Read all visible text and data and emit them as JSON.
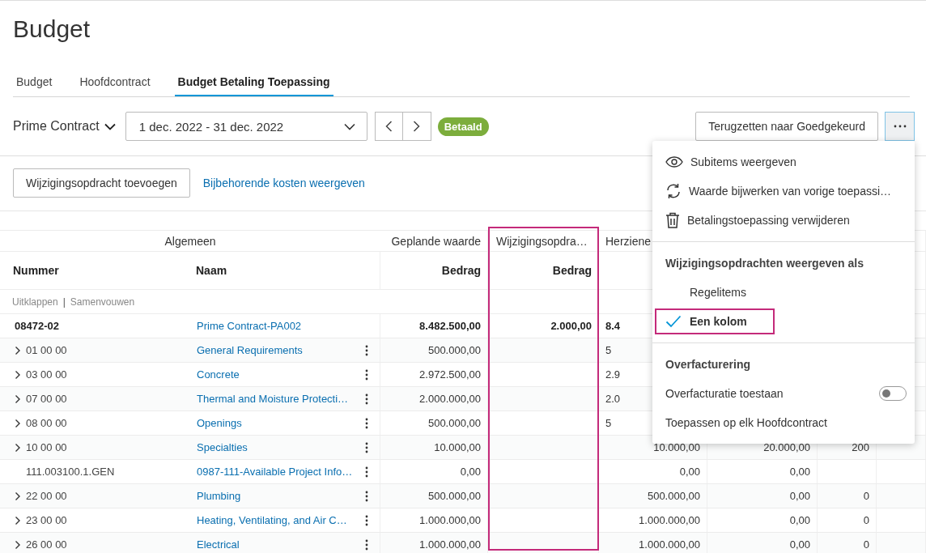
{
  "page_title": "Budget",
  "tabs": [
    {
      "label": "Budget",
      "selected": false
    },
    {
      "label": "Hoofdcontract",
      "selected": false
    },
    {
      "label": "Budget Betaling Toepassing",
      "selected": true
    }
  ],
  "contract_selector": "Prime Contract",
  "period": "1 dec. 2022 - 31 dec. 2022",
  "status_badge": "Betaald",
  "revert_button": "Terugzetten naar Goedgekeurd",
  "add_button": "Wijzigingsopdracht toevoegen",
  "costs_link": "Bijbehorende kosten weergeven",
  "table": {
    "group_headers": [
      {
        "label": "Algemeen",
        "highlighted": false
      },
      {
        "label": "Geplande waarde",
        "highlighted": false
      },
      {
        "label": "Wijzigingsopdra…",
        "highlighted": true
      },
      {
        "label": "Herziene",
        "highlighted": false
      }
    ],
    "columns": [
      "Nummer",
      "Naam",
      "Bedrag",
      "Bedrag"
    ],
    "expand_link": "Uitklappen",
    "separator": "|",
    "collapse_link": "Samenvouwen",
    "rows": [
      {
        "kind": "total",
        "expandable": false,
        "number": "08472-02",
        "name": "Prime Contract-PA002",
        "planned": "8.482.500,00",
        "change": "2.000,00",
        "revised": "8.4",
        "covered": true
      },
      {
        "kind": "item",
        "expandable": true,
        "number": "01 00 00",
        "name": "General Requirements",
        "planned": "500.000,00",
        "revised": "5",
        "covered": true
      },
      {
        "kind": "item",
        "expandable": true,
        "number": "03 00 00",
        "name": "Concrete",
        "planned": "2.972.500,00",
        "revised": "2.9",
        "covered": true
      },
      {
        "kind": "item",
        "expandable": true,
        "number": "07 00 00",
        "name": "Thermal and Moisture Protecti…",
        "planned": "2.000.000,00",
        "revised": "2.0",
        "covered": true
      },
      {
        "kind": "item",
        "expandable": true,
        "number": "08 00 00",
        "name": "Openings",
        "planned": "500.000,00",
        "revised": "5",
        "covered": true
      },
      {
        "kind": "item",
        "expandable": true,
        "number": "10 00 00",
        "name": "Specialties",
        "planned": "10.000,00",
        "revised": "10.000,00",
        "column_6": "20.000,00",
        "column_7": "200",
        "covered": false
      },
      {
        "kind": "item",
        "expandable": false,
        "number": "111.003100.1.GEN",
        "name": "0987-111-Available Project Info…",
        "planned": "0,00",
        "revised": "0,00",
        "column_6": "0,00",
        "covered": false
      },
      {
        "kind": "item",
        "expandable": true,
        "number": "22 00 00",
        "name": "Plumbing",
        "planned": "500.000,00",
        "revised": "500.000,00",
        "column_6": "0,00",
        "column_7": "0",
        "covered": false
      },
      {
        "kind": "item",
        "expandable": true,
        "number": "23 00 00",
        "name": "Heating, Ventilating, and Air C…",
        "planned": "1.000.000,00",
        "revised": "1.000.000,00",
        "column_6": "0,00",
        "column_7": "0",
        "covered": false
      },
      {
        "kind": "item",
        "expandable": true,
        "number": "26 00 00",
        "name": "Electrical",
        "planned": "1.000.000,00",
        "revised": "1.000.000,00",
        "column_6": "0,00",
        "column_7": "0",
        "covered": false
      }
    ]
  },
  "menu": {
    "items": [
      {
        "kind": "command",
        "label": "Subitems weergeven"
      },
      {
        "kind": "command",
        "label": "Waarde bijwerken van vorige toepassi…"
      },
      {
        "kind": "command",
        "label": "Betalingstoepassing verwijderen"
      },
      {
        "kind": "divider"
      },
      {
        "kind": "header",
        "label": "Wijzigingsopdrachten weergeven als"
      },
      {
        "kind": "option",
        "label": "Regelitems",
        "selected": false,
        "highlighted": false
      },
      {
        "kind": "option",
        "label": "Een kolom",
        "selected": true,
        "highlighted": true
      },
      {
        "kind": "divider"
      },
      {
        "kind": "header",
        "label": "Overfacturering"
      },
      {
        "kind": "toggle",
        "label": "Overfacturatie toestaan",
        "on": false
      },
      {
        "kind": "action",
        "label": "Toepassen op elk Hoofdcontract"
      }
    ]
  }
}
